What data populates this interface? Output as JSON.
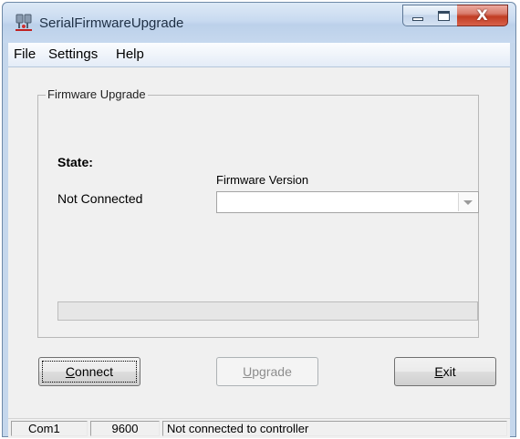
{
  "window": {
    "title": "SerialFirmwareUpgrade",
    "close_glyph": "X",
    "app_icon": "plug-icon"
  },
  "menu": {
    "items": [
      "File",
      "Settings",
      "Help"
    ]
  },
  "group": {
    "legend": "Firmware Upgrade"
  },
  "state": {
    "heading": "State:",
    "value": "Not Connected"
  },
  "firmware": {
    "label": "Firmware Version",
    "selected": ""
  },
  "progress": {
    "fraction": 0
  },
  "buttons": {
    "connect": {
      "mnemonic": "C",
      "rest": "onnect"
    },
    "upgrade": {
      "mnemonic": "U",
      "rest": "pgrade"
    },
    "exit": {
      "mnemonic": "E",
      "rest": "xit"
    }
  },
  "statusbar": {
    "port": "Com1",
    "baud": "9600",
    "message": "Not connected to controller"
  },
  "colors": {
    "title_bar": "#c8daf0",
    "close_button": "#c13d23",
    "client_bg": "#f0f0f0"
  }
}
